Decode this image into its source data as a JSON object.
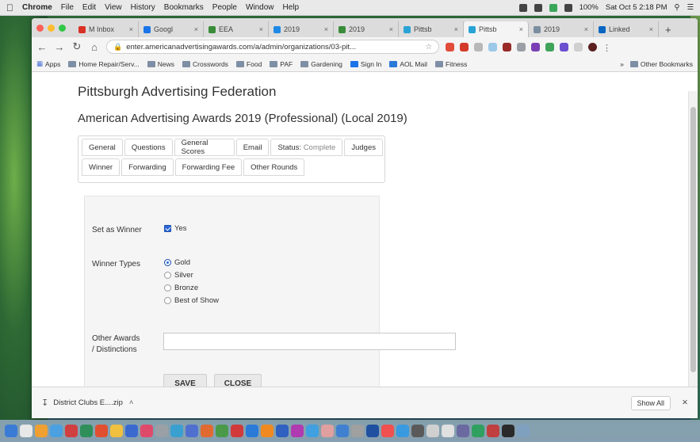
{
  "menubar": {
    "app": "Chrome",
    "items": [
      "File",
      "Edit",
      "View",
      "History",
      "Bookmarks",
      "People",
      "Window",
      "Help"
    ],
    "battery": "100%",
    "clock": "Sat Oct 5 2:18 PM"
  },
  "browser": {
    "tabs": [
      {
        "label": "M Inbox",
        "color": "#d93025"
      },
      {
        "label": "Googl",
        "color": "#1a73e8"
      },
      {
        "label": "EEA",
        "color": "#3a8c3a"
      },
      {
        "label": "2019",
        "color": "#1e88e5"
      },
      {
        "label": "2019",
        "color": "#3a8c3a"
      },
      {
        "label": "Pittsb",
        "color": "#29a3d6"
      },
      {
        "label": "Pittsb",
        "color": "#29a3d6"
      },
      {
        "label": "2019",
        "color": "#7b8ea0"
      },
      {
        "label": "Linked",
        "color": "#0a66c2"
      }
    ],
    "url": "enter.americanadvertisingawards.com/a/admin/organizations/03-pit...",
    "bookmarks": [
      "Apps",
      "Home Repair/Serv...",
      "News",
      "Crosswords",
      "Food",
      "PAF",
      "Gardening",
      "Sign In",
      "AOL Mail",
      "Fitness"
    ],
    "other_bookmarks": "Other Bookmarks"
  },
  "page": {
    "cut_heading": "Pittsburgh Advertising Federation",
    "title": "American Advertising Awards 2019 (Professional) (Local 2019)",
    "tabs_row1": [
      "General",
      "Questions",
      "General Scores",
      "Email",
      "Status:",
      "Judges"
    ],
    "status_value": "Complete",
    "tabs_row2": [
      "Winner",
      "Forwarding",
      "Forwarding Fee",
      "Other Rounds"
    ],
    "set_as_winner_label": "Set as Winner",
    "set_as_winner_option": "Yes",
    "winner_types_label": "Winner Types",
    "winner_types": [
      {
        "label": "Gold",
        "checked": true
      },
      {
        "label": "Silver",
        "checked": false
      },
      {
        "label": "Bronze",
        "checked": false
      },
      {
        "label": "Best of Show",
        "checked": false
      }
    ],
    "other_awards_label_1": "Other Awards",
    "other_awards_label_2": "/ Distinctions",
    "other_awards_value": "",
    "save_label": "SAVE",
    "close_label": "CLOSE"
  },
  "download_shelf": {
    "file": "District Clubs E....zip",
    "show_all": "Show All"
  }
}
